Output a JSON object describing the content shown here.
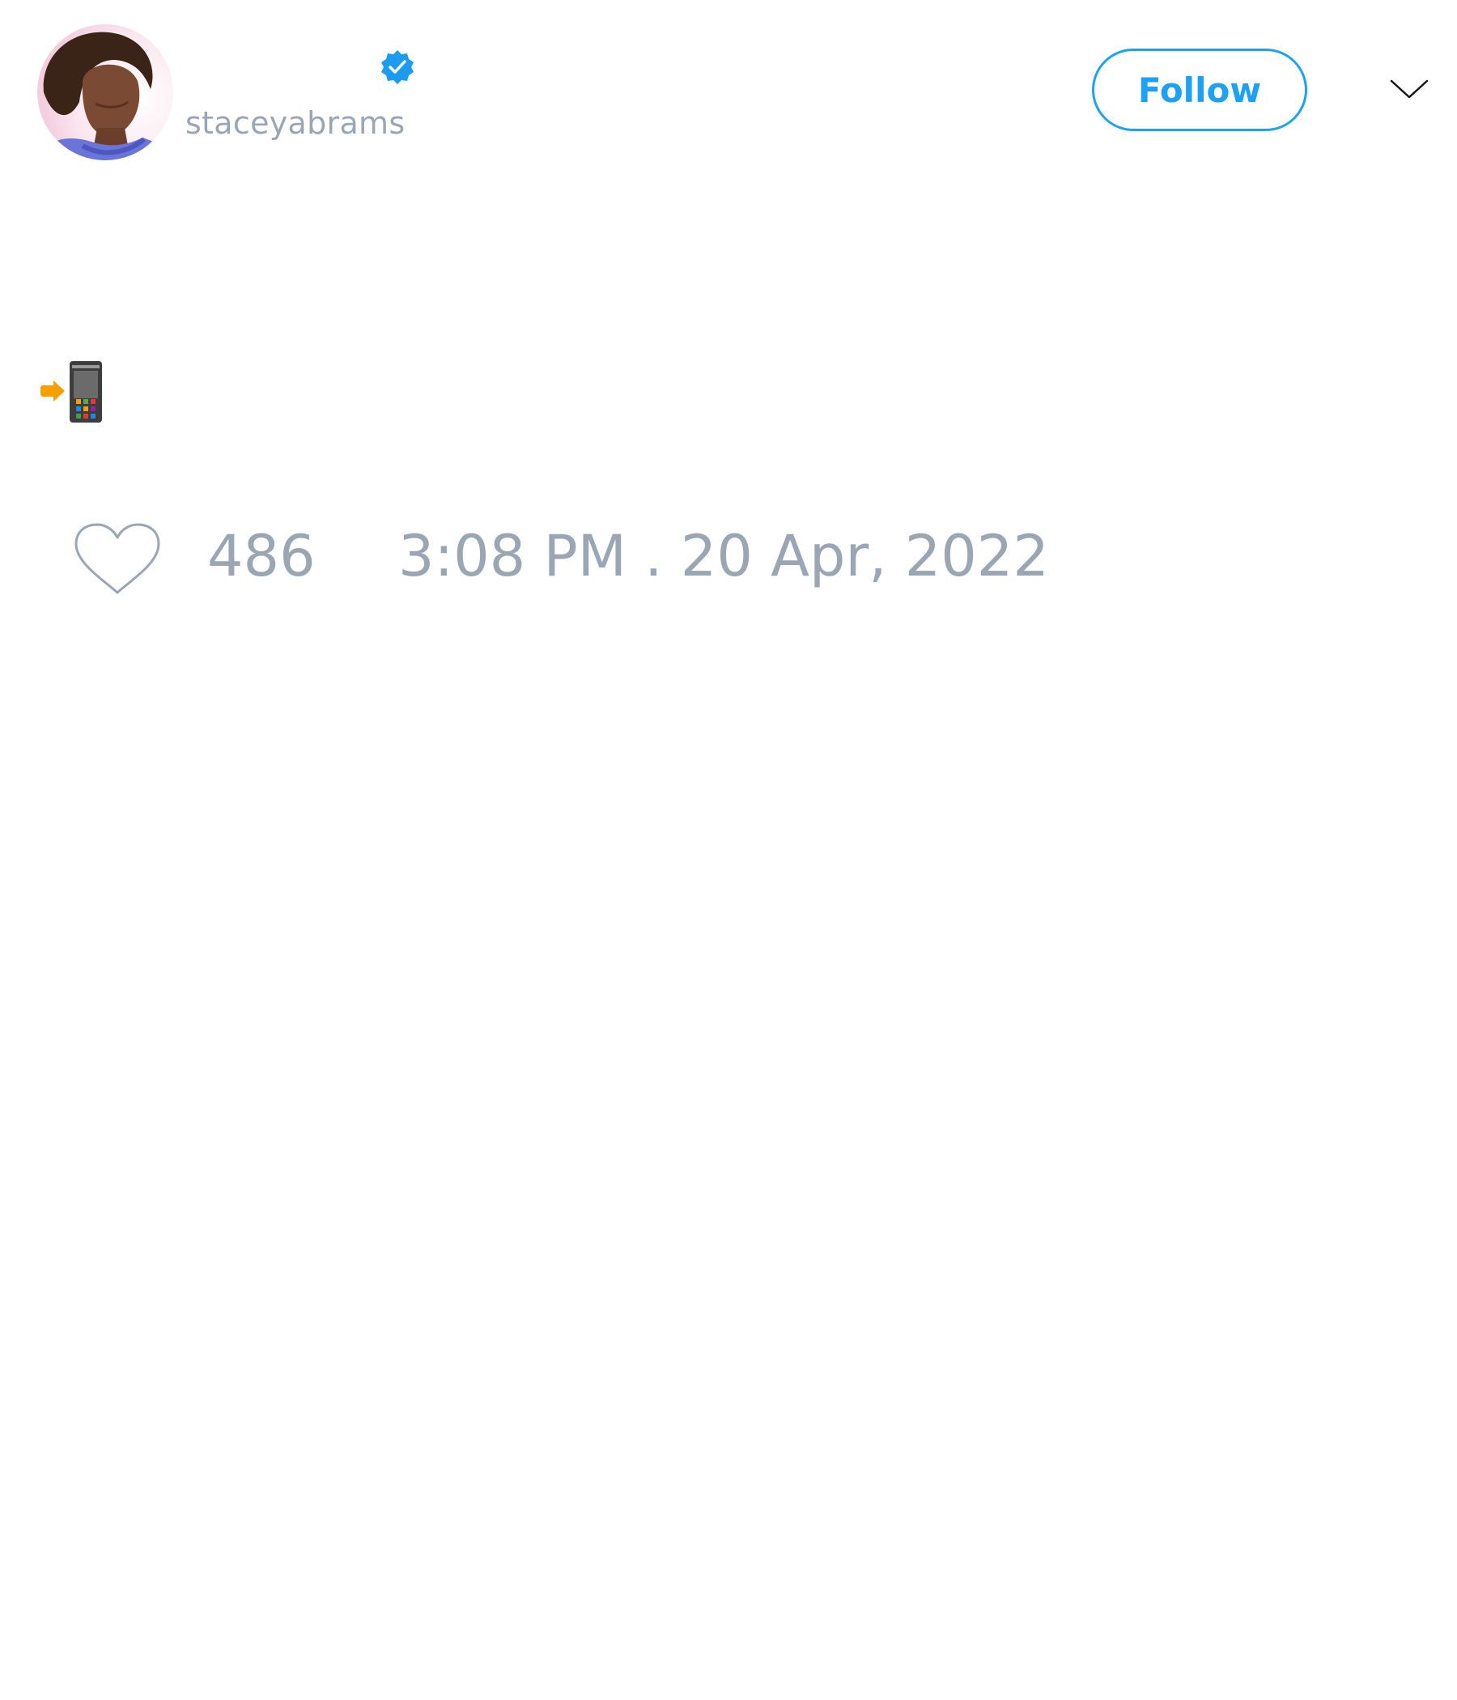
{
  "author": {
    "display_name": "",
    "handle": "staceyabrams",
    "verified": true,
    "avatar_icon": "profile-photo"
  },
  "actions": {
    "follow_label": "Follow",
    "more_icon": "chevron-down-icon"
  },
  "tweet": {
    "body_icons": [
      "arrow-right-icon",
      "mobile-phone-icon"
    ],
    "like_icon": "heart-outline-icon",
    "like_count": "486",
    "timestamp": "3:08 PM . 20 Apr, 2022"
  },
  "colors": {
    "accent": "#1da1f2",
    "muted_text": "#9aa6b4",
    "verified_badge": "#1d9bf0",
    "emoji_arrow": "#f5a000"
  }
}
